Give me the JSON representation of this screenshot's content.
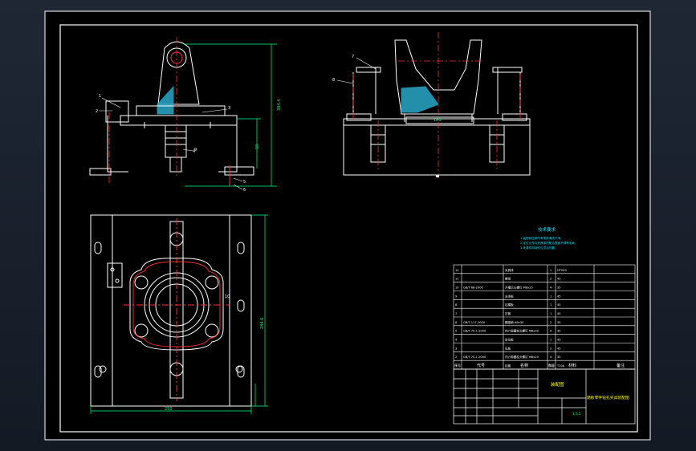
{
  "drawing": {
    "tech_title": "技术要求",
    "tech_notes": [
      "1.装配前应将所有零件清洗干净。",
      "2.定位元件与夹具体的配合表面不得有毛刺。",
      "3.夹紧机构动作应灵活可靠。"
    ],
    "title_block": {
      "name": "踏板零件钻孔夹具装配图",
      "drawing_type": "装配图",
      "scale": "1:1.5",
      "headers": {
        "seq": "序号",
        "code": "代号",
        "name": "名称",
        "qty": "数量",
        "material": "材料",
        "remark": "备注"
      }
    },
    "bom_rows": [
      {
        "seq": "12",
        "code": "",
        "name": "夹具体",
        "qty": "1",
        "material": "HT200"
      },
      {
        "seq": "11",
        "code": "",
        "name": "螺母",
        "qty": "2",
        "material": "45"
      },
      {
        "seq": "10",
        "code": "GB/T 68-2000",
        "name": "开槽沉头螺钉 M6x25",
        "qty": "4",
        "material": "35"
      },
      {
        "seq": "9",
        "code": "",
        "name": "支承板",
        "qty": "1",
        "material": "45"
      },
      {
        "seq": "8",
        "code": "",
        "name": "钻模板",
        "qty": "1",
        "material": "45"
      },
      {
        "seq": "7",
        "code": "",
        "name": "衬套",
        "qty": "1",
        "material": "45"
      },
      {
        "seq": "6",
        "code": "GB/T 117-2000",
        "name": "圆锥销 A6x30",
        "qty": "2",
        "material": "35"
      },
      {
        "seq": "5",
        "code": "GB/T 70.1-2000",
        "name": "内六角圆柱头螺钉 M8x30",
        "qty": "4",
        "material": "35"
      },
      {
        "seq": "4",
        "code": "",
        "name": "定位板",
        "qty": "1",
        "material": "45"
      },
      {
        "seq": "3",
        "code": "",
        "name": "压板",
        "qty": "2",
        "material": "45"
      },
      {
        "seq": "2",
        "code": "GB/T 70.1-2000",
        "name": "内六角圆柱头螺钉 M6x20",
        "qty": "4",
        "material": "35"
      },
      {
        "seq": "1",
        "code": "",
        "name": "钻套",
        "qty": "1",
        "material": "T10A"
      }
    ],
    "dimensions": {
      "front_height": "384.4",
      "front_small": "60",
      "top_width": "250",
      "top_height": "284.6",
      "side_width": "180"
    },
    "callouts": [
      "1",
      "2",
      "3",
      "4",
      "5",
      "6",
      "7",
      "8",
      "9",
      "10"
    ]
  }
}
